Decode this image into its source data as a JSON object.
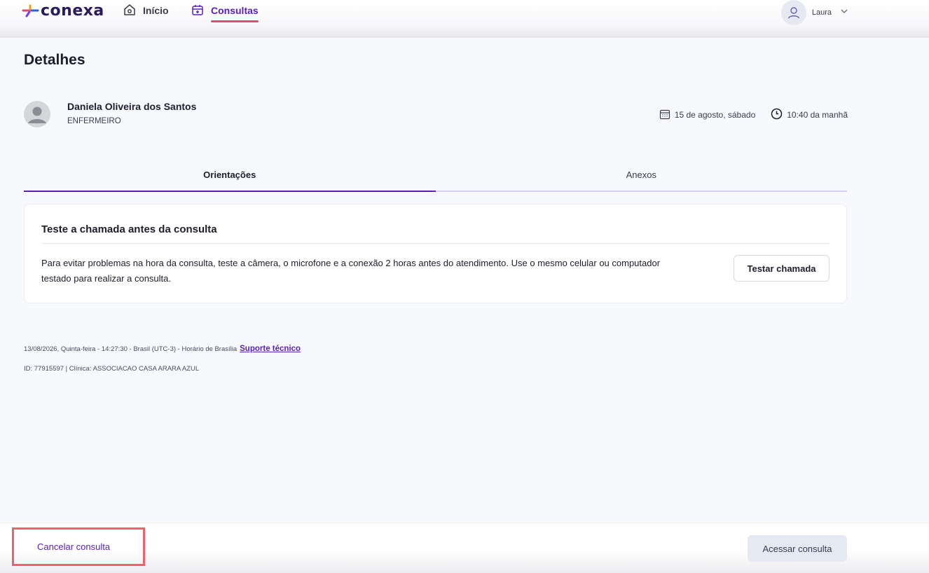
{
  "header": {
    "logo_text": "conexa",
    "nav": [
      {
        "label": "Início",
        "icon": "home-icon",
        "active": false
      },
      {
        "label": "Consultas",
        "icon": "calendar-plus-icon",
        "active": true
      }
    ],
    "user_name": "Laura",
    "colors": {
      "accent": "#5b21b6",
      "underline": "#d64f73"
    }
  },
  "page": {
    "title": "Detalhes",
    "professional": {
      "name": "Daniela Oliveira dos Santos",
      "role": "ENFERMEIRO"
    },
    "date": "15 de agosto, sábado",
    "time": "10:40 da manhã",
    "tabs": [
      {
        "label": "Orientações",
        "active": true
      },
      {
        "label": "Anexos",
        "active": false
      }
    ],
    "card": {
      "title": "Teste a chamada antes da consulta",
      "text": "Para evitar problemas na hora da consulta, teste a câmera, o microfone e a conexão 2 horas antes do atendimento. Use o mesmo celular ou computador testado para realizar a consulta.",
      "button": "Testar chamada"
    },
    "meta": {
      "timestamp": "13/08/2026, Quinta-feira - 14:27:30 - Brasil (UTC-3) - Horário de Brasília",
      "support_link": "Suporte técnico",
      "id_line": "ID: 77915597 | Clínica: ASSOCIACAO CASA ARARA AZUL"
    }
  },
  "footer": {
    "cancel_label": "Cancelar consulta",
    "access_label": "Acessar consulta"
  }
}
